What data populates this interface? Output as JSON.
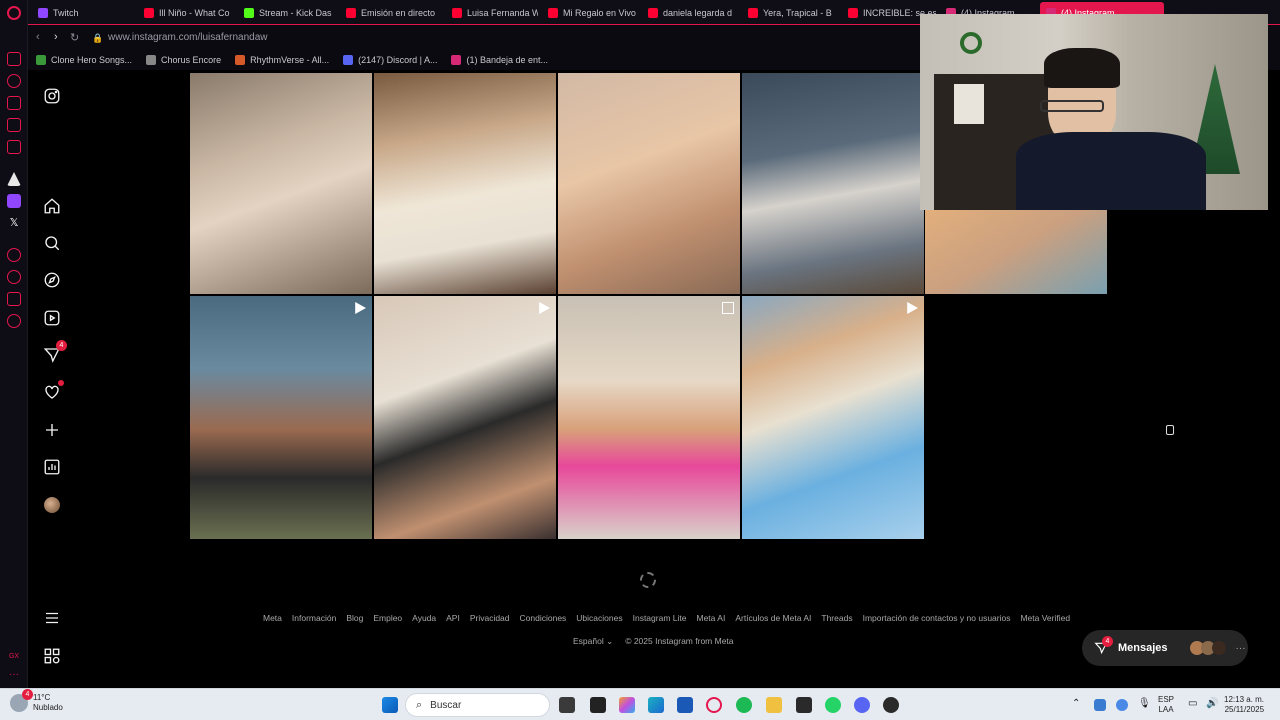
{
  "tabs": [
    {
      "label": "Twitch",
      "color": "#9146ff",
      "active": false
    },
    {
      "label": "Ill Niño - What Co",
      "color": "#ff0033",
      "active": false
    },
    {
      "label": "Stream - Kick Das",
      "color": "#53fc18",
      "active": false
    },
    {
      "label": "Emisión en directo",
      "color": "#ff0033",
      "active": false
    },
    {
      "label": "Luisa Fernanda W",
      "color": "#ff0033",
      "active": false
    },
    {
      "label": "Mi Regalo en Vivo",
      "color": "#ff0033",
      "active": false
    },
    {
      "label": "daniela legarda d",
      "color": "#ff0033",
      "active": false
    },
    {
      "label": "Yera, Trapical - B",
      "color": "#ff0033",
      "active": false
    },
    {
      "label": "INCREIBLE: se es",
      "color": "#ff0033",
      "active": false
    },
    {
      "label": "(4) Instagram",
      "color": "#d62976",
      "active": false
    },
    {
      "label": "(4) Instagram",
      "color": "#d62976",
      "active": true
    }
  ],
  "address": {
    "url": "www.instagram.com/luisafernandaw"
  },
  "bookmarks": [
    {
      "label": "Clone Hero Songs...",
      "color": "#3a9a3a"
    },
    {
      "label": "Chorus Encore",
      "color": "#888888"
    },
    {
      "label": "RhythmVerse - All...",
      "color": "#d45a2a"
    },
    {
      "label": "(2147) Discord | A...",
      "color": "#5865f2"
    },
    {
      "label": "(1) Bandeja de ent...",
      "color": "#d62976"
    }
  ],
  "nav": {
    "notifications_badge": "4"
  },
  "grid": {
    "row1": [
      {
        "reel": false,
        "g": "linear-gradient(160deg,#8a7a6a 0%,#c9b7a4 35%,#e4d3c2 55%,#7c6a5a 100%)"
      },
      {
        "reel": false,
        "g": "linear-gradient(170deg,#7a5a40 0%,#c9a98a 30%,#efe6d6 55%,#e8e1d4 75%,#5a4030 100%)"
      },
      {
        "reel": false,
        "g": "linear-gradient(160deg,#d2b9a5 0%,#e8c6a6 40%,#c09070 70%,#8a6a55 100%)"
      },
      {
        "reel": false,
        "g": "linear-gradient(170deg,#3a4a5a 0%,#5a6a7a 35%,#d6d2cc 55%,#6a7480 80%,#5a4a3a 100%)"
      },
      {
        "reel": false,
        "g": "linear-gradient(150deg,#c7966c 0%,#e4b07c 40%,#caa080 70%,#7aa0b0 100%)"
      }
    ],
    "row2": [
      {
        "reel": true,
        "g": "linear-gradient(180deg,#4a6a80 0%,#6a8aa0 30%,#9a6a50 55%,#2a2a2a 75%,#6a7050 100%)"
      },
      {
        "reel": true,
        "g": "linear-gradient(160deg,#d8c8b8 0%,#e8e0d4 35%,#2a2a2a 55%,#c09070 80%,#3a3030 100%)"
      },
      {
        "reel": false,
        "carousel": true,
        "g": "linear-gradient(180deg,#c8c0b4 0%,#e6d8c6 35%,#d8a07a 55%,#e8489a 70%,#d8d2ca 100%)"
      },
      {
        "reel": true,
        "g": "linear-gradient(160deg,#8aa8c0 0%,#d8b08a 25%,#e8e0d0 45%,#6ab0e0 70%,#a8d0ec 100%)"
      }
    ]
  },
  "footer": {
    "links": [
      "Meta",
      "Información",
      "Blog",
      "Empleo",
      "Ayuda",
      "API",
      "Privacidad",
      "Condiciones",
      "Ubicaciones",
      "Instagram Lite",
      "Meta AI",
      "Artículos de Meta AI",
      "Threads",
      "Importación de contactos y no usuarios",
      "Meta Verified"
    ],
    "language": "Español",
    "copyright": "© 2025 Instagram from Meta"
  },
  "messages": {
    "label": "Mensajes",
    "badge": "4"
  },
  "taskbar": {
    "weather_temp": "11°C",
    "weather_desc": "Nublado",
    "weather_badge": "4",
    "search_placeholder": "Buscar",
    "lang": "ESP",
    "lang_sub": "LAA",
    "time": "12:13 a. m.",
    "date": "25/11/2025"
  }
}
